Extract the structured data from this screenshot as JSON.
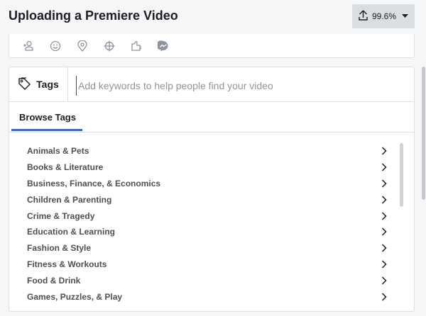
{
  "header": {
    "title": "Uploading a Premiere Video",
    "upload_progress": "99.6%",
    "upload_icon": "upload-arrow-icon",
    "caret_icon": "caret-down-icon"
  },
  "toolbar": {
    "icons": [
      "tag-people-icon",
      "feeling-emoji-icon",
      "location-pin-icon",
      "crosshair-icon",
      "sponsor-handshake-icon",
      "messenger-icon"
    ]
  },
  "tags": {
    "label": "Tags",
    "icon": "tag-icon",
    "placeholder": "Add keywords to help people find your video"
  },
  "browse": {
    "tab_label": "Browse Tags",
    "categories": [
      "Animals & Pets",
      "Books & Literature",
      "Business, Finance, & Economics",
      "Children & Parenting",
      "Crime & Tragedy",
      "Education & Learning",
      "Fashion & Style",
      "Fitness & Workouts",
      "Food & Drink",
      "Games, Puzzles, & Play"
    ]
  },
  "colors": {
    "accent": "#4267b2",
    "background": "#f5f6f7",
    "text": "#1c1e21",
    "muted_text": "#90949c"
  }
}
